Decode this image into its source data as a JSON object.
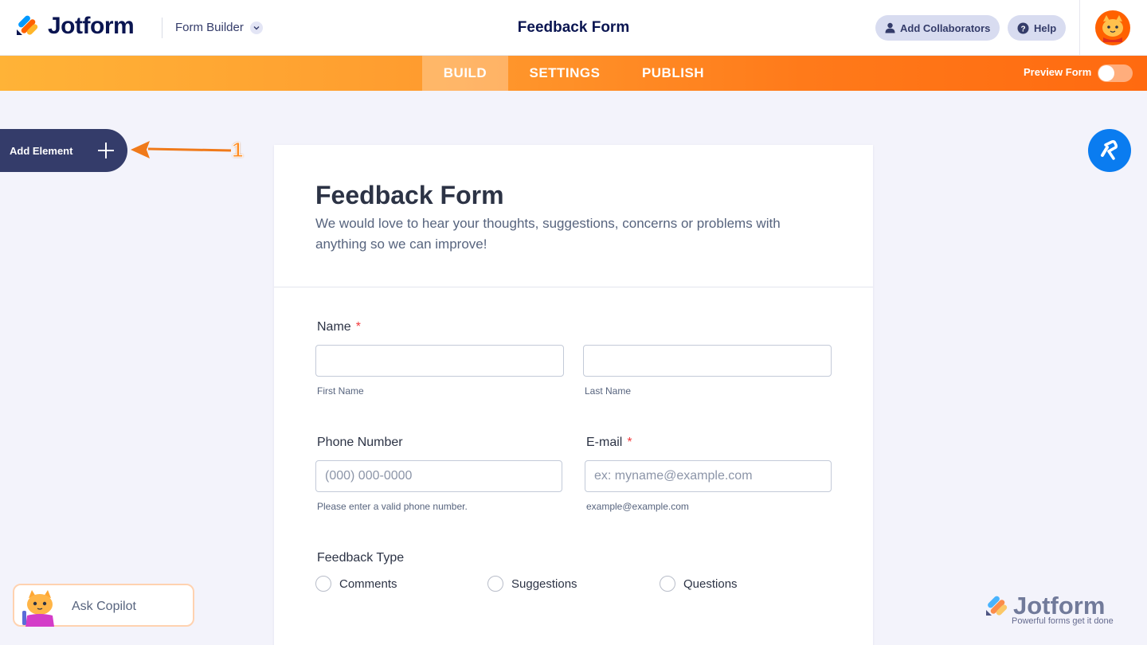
{
  "header": {
    "brand": "Jotform",
    "product_menu": "Form Builder",
    "form_name": "Feedback Form",
    "add_collaborators": "Add Collaborators",
    "help": "Help"
  },
  "nav": {
    "tabs": [
      "BUILD",
      "SETTINGS",
      "PUBLISH"
    ],
    "active_tab": "BUILD",
    "preview_label": "Preview Form",
    "preview_enabled": false
  },
  "sidebar": {
    "add_element": "Add Element",
    "annotation_number": "1"
  },
  "form": {
    "title": "Feedback Form",
    "description": "We would love to hear your thoughts, suggestions, concerns or problems with anything so we can improve!",
    "fields": {
      "name": {
        "label": "Name",
        "required_mark": "*",
        "first_sublabel": "First Name",
        "last_sublabel": "Last Name"
      },
      "phone": {
        "label": "Phone Number",
        "placeholder": "(000) 000-0000",
        "sublabel": "Please enter a valid phone number."
      },
      "email": {
        "label": "E-mail",
        "required_mark": "*",
        "placeholder": "ex: myname@example.com",
        "sublabel": "example@example.com"
      },
      "feedback_type": {
        "label": "Feedback Type",
        "options": [
          "Comments",
          "Suggestions",
          "Questions"
        ]
      }
    }
  },
  "copilot": {
    "label": "Ask Copilot"
  },
  "watermark": {
    "brand": "Jotform",
    "tagline": "Powerful forms get it done"
  },
  "colors": {
    "navy": "#0a1551",
    "orange": "#ff6100",
    "blue": "#0a7cf0",
    "required_red": "#f23a3c"
  }
}
